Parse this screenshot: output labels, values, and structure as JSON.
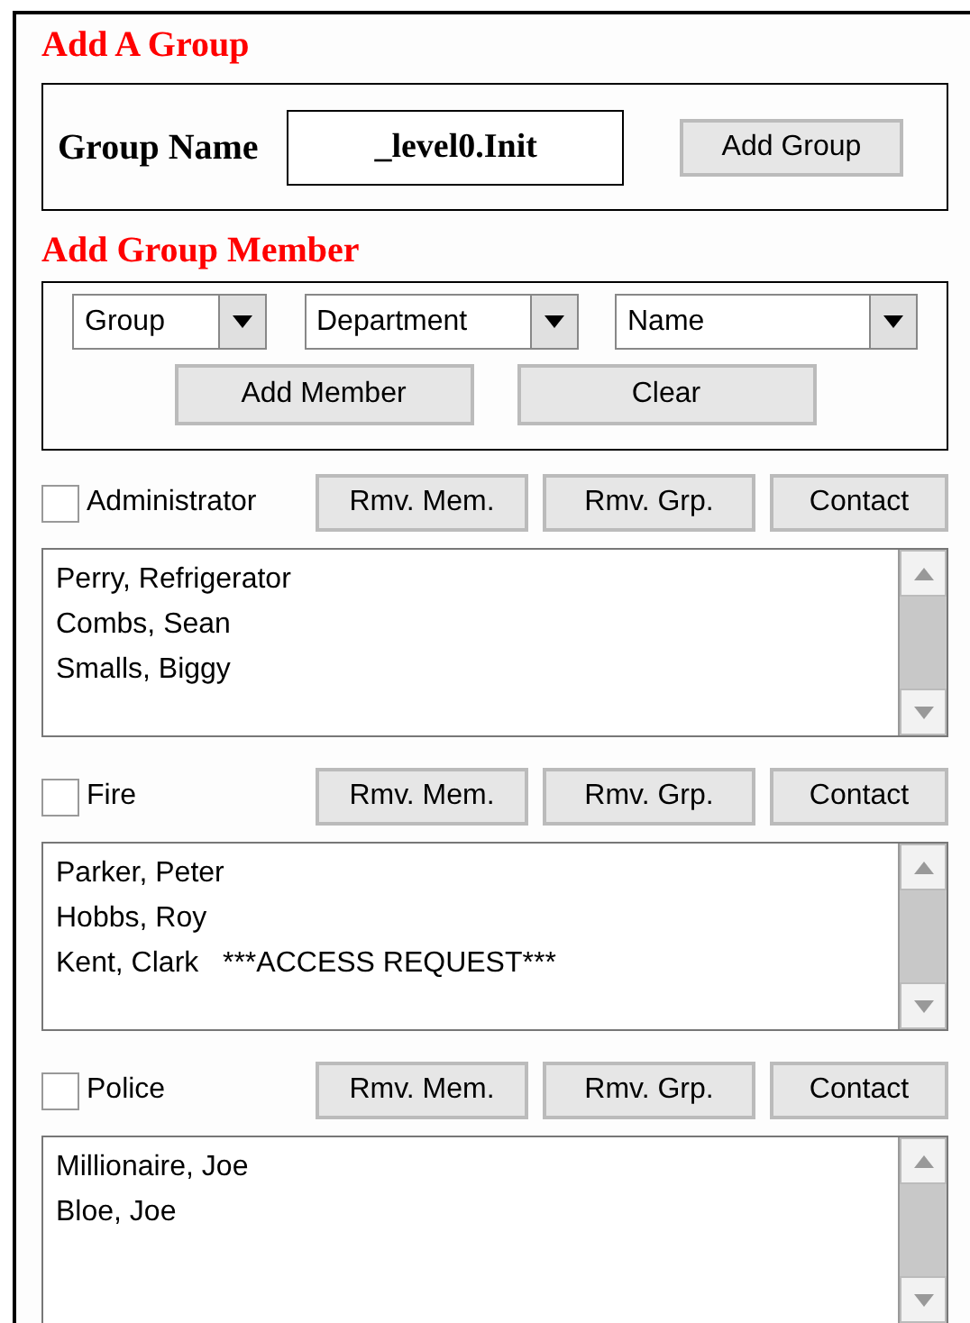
{
  "add_group": {
    "title": "Add A Group",
    "label": "Group Name",
    "value": "_level0.Init",
    "button": "Add Group"
  },
  "add_member": {
    "title": "Add Group Member",
    "selects": [
      {
        "value": "Group"
      },
      {
        "value": "Department"
      },
      {
        "value": "Name"
      }
    ],
    "buttons": [
      "Add Member",
      "Clear"
    ]
  },
  "groups": [
    {
      "name": "Administrator",
      "checked": false,
      "buttons": [
        "Rmv. Mem.",
        "Rmv. Grp.",
        "Contact"
      ],
      "members": [
        "Perry, Refrigerator",
        "Combs, Sean",
        "Smalls, Biggy"
      ]
    },
    {
      "name": "Fire",
      "checked": false,
      "buttons": [
        "Rmv. Mem.",
        "Rmv. Grp.",
        "Contact"
      ],
      "members": [
        "Parker, Peter",
        "Hobbs, Roy",
        "Kent, Clark   ***ACCESS REQUEST***"
      ]
    },
    {
      "name": "Police",
      "checked": false,
      "buttons": [
        "Rmv. Mem.",
        "Rmv. Grp.",
        "Contact"
      ],
      "members": [
        "Millionaire, Joe",
        "Bloe, Joe"
      ]
    }
  ]
}
